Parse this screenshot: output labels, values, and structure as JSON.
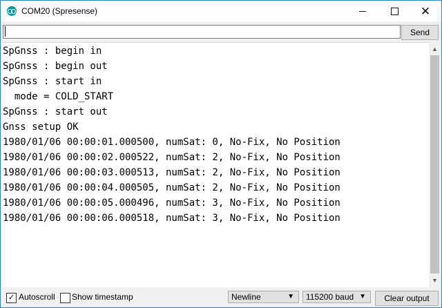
{
  "window": {
    "title": "COM20 (Spresense)"
  },
  "controls": {
    "minimize": "—",
    "maximize": "☐",
    "close": "✕"
  },
  "input": {
    "value": "",
    "send_label": "Send"
  },
  "output": {
    "lines": [
      "SpGnss : begin in",
      "SpGnss : begin out",
      "SpGnss : start in",
      "  mode = COLD_START",
      "SpGnss : start out",
      "Gnss setup OK",
      "1980/01/06 00:00:01.000500, numSat: 0, No-Fix, No Position",
      "1980/01/06 00:00:02.000522, numSat: 2, No-Fix, No Position",
      "1980/01/06 00:00:03.000513, numSat: 2, No-Fix, No Position",
      "1980/01/06 00:00:04.000505, numSat: 2, No-Fix, No Position",
      "1980/01/06 00:00:05.000496, numSat: 3, No-Fix, No Position",
      "1980/01/06 00:00:06.000518, numSat: 3, No-Fix, No Position"
    ]
  },
  "bottom": {
    "autoscroll": {
      "label": "Autoscroll",
      "checked": true
    },
    "timestamp": {
      "label": "Show timestamp",
      "checked": false
    },
    "line_ending": "Newline",
    "baud": "115200 baud",
    "clear_label": "Clear output"
  },
  "colors": {
    "accent": "#00979c",
    "border": "#1e88c8"
  }
}
